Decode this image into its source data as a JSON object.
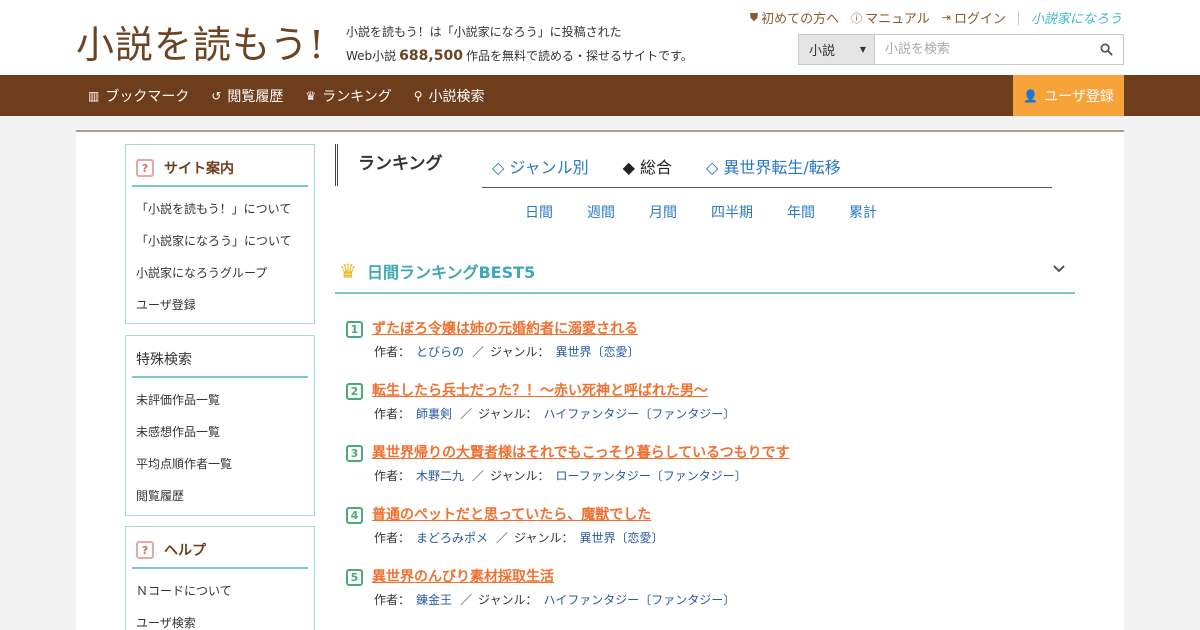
{
  "header": {
    "logo": "小説を読もう!",
    "tagline_line1": "小説を読もう！は「小説家になろう」に投稿された",
    "tagline_prefix": "Web小説",
    "novel_count": "688,500",
    "tagline_suffix": "作品を無料で読める・探せるサイトです。",
    "links": {
      "first_time": "初めての方へ",
      "manual": "マニュアル",
      "login": "ログイン",
      "brand": "小説家になろう"
    },
    "search": {
      "category": "小説",
      "placeholder": "小説を検索"
    }
  },
  "nav": {
    "bookmark": "ブックマーク",
    "history": "閲覧履歴",
    "ranking": "ランキング",
    "search": "小説検索",
    "register": "ユーザ登録"
  },
  "sidebar": {
    "site_guide": {
      "title": "サイト案内",
      "items": [
        "「小説を読もう！」について",
        "「小説家になろう」について",
        "小説家になろうグループ",
        "ユーザ登録"
      ]
    },
    "special_search": {
      "title": "特殊検索",
      "items": [
        "未評価作品一覧",
        "未感想作品一覧",
        "平均点順作者一覧",
        "閲覧履歴"
      ]
    },
    "help": {
      "title": "ヘルプ",
      "items": [
        "Ｎコードについて",
        "ユーザ検索"
      ]
    }
  },
  "ranking": {
    "title": "ランキング",
    "tabs": [
      "◇ ジャンル別",
      "◆ 総合",
      "◇ 異世界転生/転移"
    ],
    "periods": [
      "日間",
      "週間",
      "月間",
      "四半期",
      "年間",
      "累計"
    ],
    "best_title": "日間ランキングBEST5",
    "author_label": "作者：",
    "genre_label": "ジャンル：",
    "slash": "／",
    "items": [
      {
        "rank": "1",
        "title": "ずたぼろ令嬢は姉の元婚約者に溺愛される",
        "author": "とびらの",
        "genre": "異世界〔恋愛〕"
      },
      {
        "rank": "2",
        "title": "転生したら兵士だった？！～赤い死神と呼ばれた男～",
        "author": "師裏剣",
        "genre": "ハイファンタジー〔ファンタジー〕"
      },
      {
        "rank": "3",
        "title": "異世界帰りの大賢者様はそれでもこっそり暮らしているつもりです",
        "author": "木野二九",
        "genre": "ローファンタジー〔ファンタジー〕"
      },
      {
        "rank": "4",
        "title": "普通のペットだと思っていたら、魔獣でした",
        "author": "まどろみポメ",
        "genre": "異世界〔恋愛〕"
      },
      {
        "rank": "5",
        "title": "異世界のんびり素材採取生活",
        "author": "錬金王",
        "genre": "ハイファンタジー〔ファンタジー〕"
      }
    ]
  }
}
